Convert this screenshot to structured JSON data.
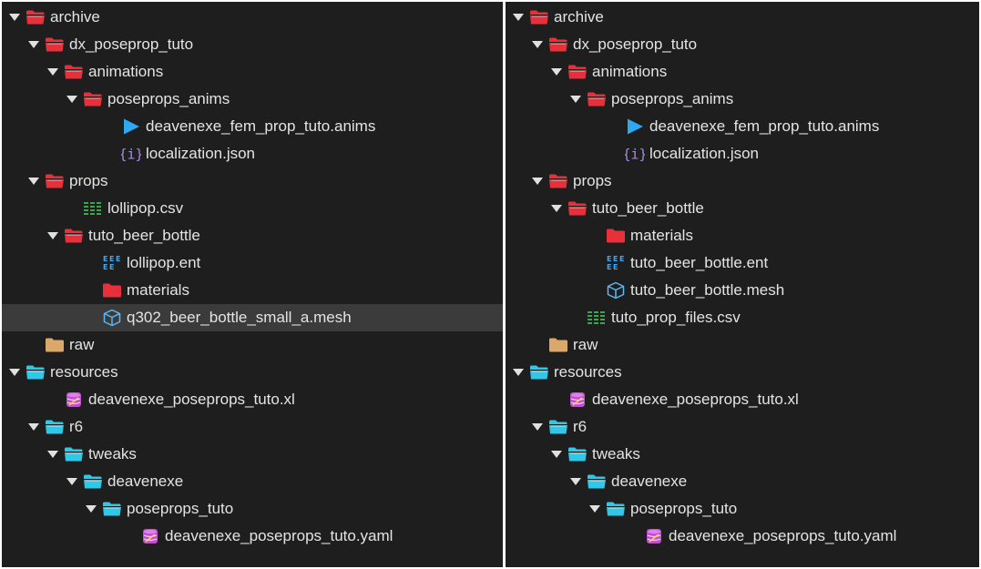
{
  "colors": {
    "folder_red": "#e8303a",
    "folder_cyan": "#2ec8e8",
    "folder_tan": "#d9a86a",
    "anims_blue": "#2ea8f0",
    "json_purple": "#a98ae0",
    "csv_green": "#3aa84a",
    "ent_blue": "#3fa7f5",
    "mesh_blue": "#5ab8f5",
    "db_purple": "#c04fd0"
  },
  "left": {
    "rows": [
      {
        "label": "archive",
        "indent": 0,
        "expanded": true,
        "icon": "folder-red-open-icon"
      },
      {
        "label": "dx_poseprop_tuto",
        "indent": 1,
        "expanded": true,
        "icon": "folder-red-open-icon"
      },
      {
        "label": "animations",
        "indent": 2,
        "expanded": true,
        "icon": "folder-red-open-icon"
      },
      {
        "label": "poseprops_anims",
        "indent": 3,
        "expanded": true,
        "icon": "folder-red-open-icon"
      },
      {
        "label": "deavenexe_fem_prop_tuto.anims",
        "indent": 5,
        "expanded": null,
        "icon": "anims-play-icon"
      },
      {
        "label": "localization.json",
        "indent": 5,
        "expanded": null,
        "icon": "json-braces-icon"
      },
      {
        "label": "props",
        "indent": 1,
        "expanded": true,
        "icon": "folder-red-open-icon"
      },
      {
        "label": "lollipop.csv",
        "indent": 3,
        "expanded": null,
        "icon": "csv-icon"
      },
      {
        "label": "tuto_beer_bottle",
        "indent": 2,
        "expanded": true,
        "icon": "folder-red-open-icon"
      },
      {
        "label": "lollipop.ent",
        "indent": 4,
        "expanded": null,
        "icon": "ent-icon"
      },
      {
        "label": "materials",
        "indent": 4,
        "expanded": null,
        "icon": "folder-red-closed-icon"
      },
      {
        "label": "q302_beer_bottle_small_a.mesh",
        "indent": 4,
        "expanded": null,
        "icon": "mesh-cube-icon",
        "selected": true
      },
      {
        "label": "raw",
        "indent": 1,
        "expanded": null,
        "icon": "folder-tan-closed-icon"
      },
      {
        "label": "resources",
        "indent": 0,
        "expanded": true,
        "icon": "folder-cyan-open-icon"
      },
      {
        "label": "deavenexe_poseprops_tuto.xl",
        "indent": 2,
        "expanded": null,
        "icon": "database-icon"
      },
      {
        "label": "r6",
        "indent": 1,
        "expanded": true,
        "icon": "folder-cyan-open-icon"
      },
      {
        "label": "tweaks",
        "indent": 2,
        "expanded": true,
        "icon": "folder-cyan-open-icon"
      },
      {
        "label": "deavenexe",
        "indent": 3,
        "expanded": true,
        "icon": "folder-cyan-open-icon"
      },
      {
        "label": "poseprops_tuto",
        "indent": 4,
        "expanded": true,
        "icon": "folder-cyan-open-icon"
      },
      {
        "label": "deavenexe_poseprops_tuto.yaml",
        "indent": 6,
        "expanded": null,
        "icon": "database-icon"
      }
    ]
  },
  "right": {
    "rows": [
      {
        "label": "archive",
        "indent": 0,
        "expanded": true,
        "icon": "folder-red-open-icon"
      },
      {
        "label": "dx_poseprop_tuto",
        "indent": 1,
        "expanded": true,
        "icon": "folder-red-open-icon"
      },
      {
        "label": "animations",
        "indent": 2,
        "expanded": true,
        "icon": "folder-red-open-icon"
      },
      {
        "label": "poseprops_anims",
        "indent": 3,
        "expanded": true,
        "icon": "folder-red-open-icon"
      },
      {
        "label": "deavenexe_fem_prop_tuto.anims",
        "indent": 5,
        "expanded": null,
        "icon": "anims-play-icon"
      },
      {
        "label": "localization.json",
        "indent": 5,
        "expanded": null,
        "icon": "json-braces-icon"
      },
      {
        "label": "props",
        "indent": 1,
        "expanded": true,
        "icon": "folder-red-open-icon"
      },
      {
        "label": "tuto_beer_bottle",
        "indent": 2,
        "expanded": true,
        "icon": "folder-red-open-icon"
      },
      {
        "label": "materials",
        "indent": 4,
        "expanded": null,
        "icon": "folder-red-closed-icon"
      },
      {
        "label": "tuto_beer_bottle.ent",
        "indent": 4,
        "expanded": null,
        "icon": "ent-icon"
      },
      {
        "label": "tuto_beer_bottle.mesh",
        "indent": 4,
        "expanded": null,
        "icon": "mesh-cube-icon"
      },
      {
        "label": "tuto_prop_files.csv",
        "indent": 3,
        "expanded": null,
        "icon": "csv-icon"
      },
      {
        "label": "raw",
        "indent": 1,
        "expanded": null,
        "icon": "folder-tan-closed-icon"
      },
      {
        "label": "resources",
        "indent": 0,
        "expanded": true,
        "icon": "folder-cyan-open-icon"
      },
      {
        "label": "deavenexe_poseprops_tuto.xl",
        "indent": 2,
        "expanded": null,
        "icon": "database-icon"
      },
      {
        "label": "r6",
        "indent": 1,
        "expanded": true,
        "icon": "folder-cyan-open-icon"
      },
      {
        "label": "tweaks",
        "indent": 2,
        "expanded": true,
        "icon": "folder-cyan-open-icon"
      },
      {
        "label": "deavenexe",
        "indent": 3,
        "expanded": true,
        "icon": "folder-cyan-open-icon"
      },
      {
        "label": "poseprops_tuto",
        "indent": 4,
        "expanded": true,
        "icon": "folder-cyan-open-icon"
      },
      {
        "label": "deavenexe_poseprops_tuto.yaml",
        "indent": 6,
        "expanded": null,
        "icon": "database-icon"
      }
    ]
  }
}
